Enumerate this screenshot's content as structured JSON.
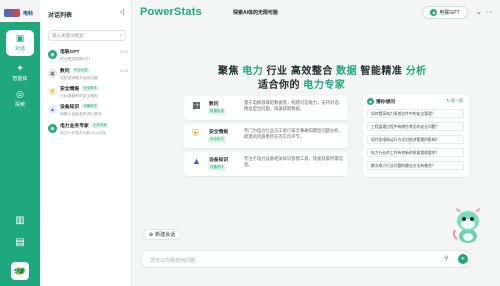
{
  "logo": {
    "name": "电科"
  },
  "rail": {
    "items": [
      {
        "label": "对话",
        "icon": "chat-icon"
      },
      {
        "label": "智能体",
        "icon": "agent-icon"
      },
      {
        "label": "探索",
        "icon": "explore-icon"
      }
    ],
    "bottom_icons": [
      "sidebar-icon",
      "document-icon"
    ],
    "avatar": "avatar-icon"
  },
  "panel": {
    "title": "对话列表",
    "search_placeholder": "输入关键词搜索",
    "conversations": [
      {
        "name": "电联GPT",
        "tag": "",
        "time": "11:30",
        "sub": "欢迎使用电联GPT"
      },
      {
        "name": "数问",
        "tag": "专业问答",
        "time": "11:29",
        "sub": "您想咨询哪方面的问题"
      },
      {
        "name": "安全情报",
        "tag": "安全助手",
        "time": "2024/04/25",
        "sub": "已获取最新的安全情报"
      },
      {
        "name": "设备知识",
        "tag": "设备助手",
        "time": "2024/04/20",
        "sub": "请输入设备名称进行查询"
      },
      {
        "name": "电力业务专家",
        "tag": "业务专家",
        "time": "2024/04/16",
        "sub": "电力行业相关问题可以问我"
      }
    ],
    "new_chat": "新建会话"
  },
  "header": {
    "brand": "PowerStats",
    "subtitle": "探索AI体的无限可能",
    "model": "电联GPT"
  },
  "hero": {
    "line1_a": "聚焦 ",
    "line1_b": "电力",
    "line1_c": " 行业  高效整合 ",
    "line1_d": "数据",
    "line1_e": " 智能精准 ",
    "line1_f": "分析",
    "line2_a": "适合你的 ",
    "line2_b": "电力专家"
  },
  "cards": [
    {
      "name": "数问",
      "tag": "数据检索",
      "desc": "基于电网领域的数据库，构建问答能力，支持对话、精准定位问题，快速获取数据。",
      "icon": "database-icon"
    },
    {
      "name": "安全情报",
      "tag": "安全助手",
      "desc": "专门为电力行业员工进行安全事故和典型问题分析，梳理风险隐患所在的工作环节。",
      "icon": "shield-icon"
    },
    {
      "name": "设备知识",
      "tag": "设备助手",
      "desc": "专注于电力设备相关知识管理工具，快速获取所需信息。",
      "icon": "device-icon"
    }
  ],
  "guess": {
    "title": "猜你想问",
    "refresh": "换一换",
    "questions": [
      "如何提高电力系统文件中的安全管理？",
      "工程监理过程中有哪些常见的安全问题？",
      "现代化电网运行方式对经济管理的影响？",
      "电力行业的工作有何新的质量管理要求？",
      "解决电力行业问题的最佳方法有哪些？"
    ]
  },
  "input": {
    "placeholder": "您可以向我任何问题"
  },
  "colors": {
    "accent": "#1fa77d",
    "rail": "#1fa77d",
    "background": "#f3f6f5"
  }
}
